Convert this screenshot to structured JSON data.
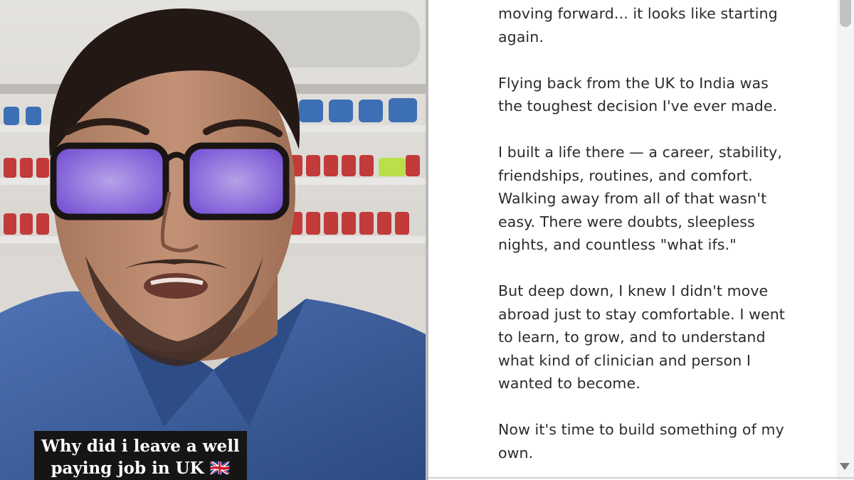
{
  "video": {
    "caption_line1": "Why did i leave a well",
    "caption_line2": "paying job in UK 🇬🇧"
  },
  "post": {
    "text": "moving forward... it looks like starting\nagain.\n\nFlying back from the UK to India was\nthe toughest decision I've ever made.\n\nI built a life there — a career, stability,\nfriendships, routines, and comfort.\nWalking away from all of that wasn't\neasy. There were doubts, sleepless\nnights, and countless \"what ifs.\"\n\nBut deep down, I knew I didn't move\nabroad just to stay comfortable. I went\nto learn, to grow, and to understand\nwhat kind of clinician and person I\nwanted to become.\n\nNow it's time to build something of my\nown."
  },
  "colors": {
    "text": "#2b2b2b",
    "shirt": "#3e5f9c",
    "glasses_tint": "#8b6cf5",
    "caption_bg": "#151515"
  }
}
